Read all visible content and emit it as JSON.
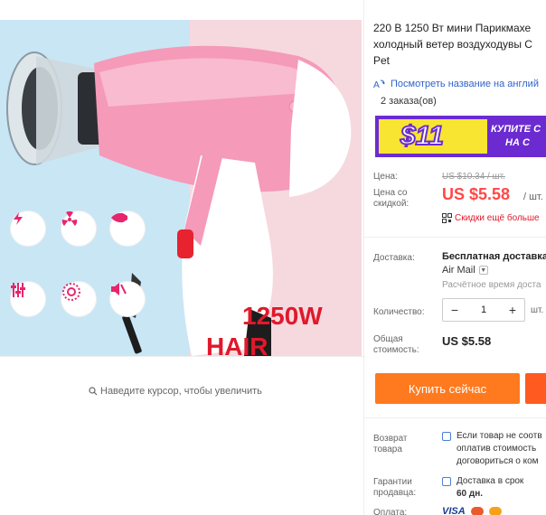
{
  "gallery": {
    "promo_line1": "1250W",
    "promo_line2": "HAIR DRYER",
    "zoom_hint": "Наведите курсор, чтобы увеличить",
    "feature_icons": [
      "lightning-icon",
      "radiation-icon",
      "hair-icon",
      "adjust-icon",
      "heat-coil-icon",
      "mute-icon"
    ]
  },
  "product": {
    "title": "220 В 1250 Вт мини Парикмахе\nхолодный ветер воздуходувы С\nPet",
    "translate_link": "Посмотреть название на англий",
    "orders": "2 заказа(ов)"
  },
  "promo": {
    "amount": "$11",
    "cta_line1": "КУПИТЕ С",
    "cta_line2": "НА С"
  },
  "price": {
    "label_price": "Цена:",
    "old_price": "US $10.34 / шт.",
    "label_discount_1": "Цена со",
    "label_discount_2": "скидкой:",
    "new_price": "US $5.58",
    "per_unit": "/ шт.",
    "discount_link": "Скидки ещё больше"
  },
  "shipping": {
    "label": "Доставка:",
    "value": "Бесплатная доставка",
    "carrier": "Air Mail",
    "eta": "Расчётное время доста"
  },
  "quantity": {
    "label": "Количество:",
    "value": "1",
    "minus": "−",
    "plus": "+",
    "unit": "шт. ("
  },
  "total": {
    "label_1": "Общая",
    "label_2": "стоимость:",
    "value": "US $5.58"
  },
  "actions": {
    "buy_now": "Купить сейчас"
  },
  "return": {
    "label_1": "Возврат",
    "label_2": "товара",
    "line1": "Если товар не соотв",
    "line2": "оплатив стоимость",
    "line3": "договориться о ком"
  },
  "guarantee": {
    "label_1": "Гарантии",
    "label_2": "продавца:",
    "line1": "Доставка в срок",
    "line2": "60 дн."
  },
  "payment": {
    "label": "Оплата:",
    "visa": "VISA"
  },
  "colors": {
    "accent_red": "#ff4747",
    "buy_orange": "#ff7a1f",
    "link_blue": "#2f64c8",
    "promo_purple": "#6c2bd1",
    "promo_yellow": "#f7e531"
  }
}
